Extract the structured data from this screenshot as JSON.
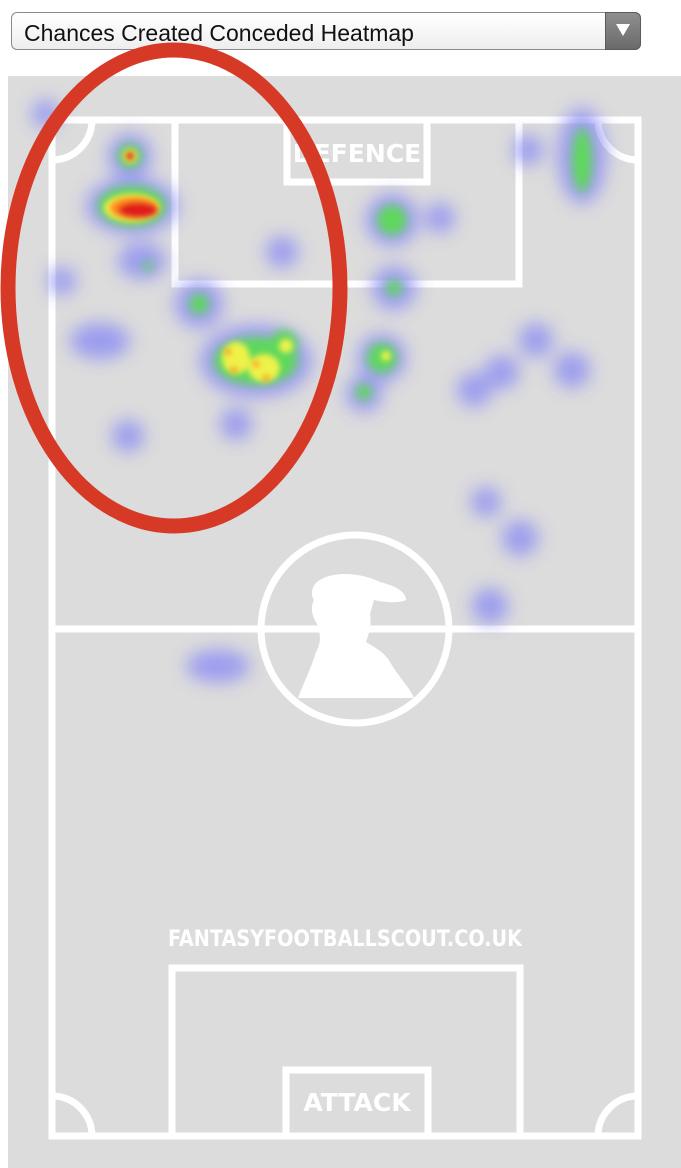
{
  "selector": {
    "selected_label": "Chances Created Conceded Heatmap",
    "arrow_icon": "triangle-down-icon"
  },
  "pitch": {
    "top_label": "DEFENCE",
    "bottom_label": "ATTACK",
    "watermark": "FANTASYFOOTBALLSCOUT.CO.UK",
    "center_icon": "scout-silhouette-icon",
    "background_color": "#dcdcdc",
    "line_color": "#ffffff"
  },
  "annotation": {
    "shape": "ellipse",
    "color": "#d63a27"
  },
  "heatmap": {
    "palette": [
      "#7b7bff",
      "#5bd85b",
      "#f2f24a",
      "#ff8a1a",
      "#e01b1b"
    ]
  }
}
